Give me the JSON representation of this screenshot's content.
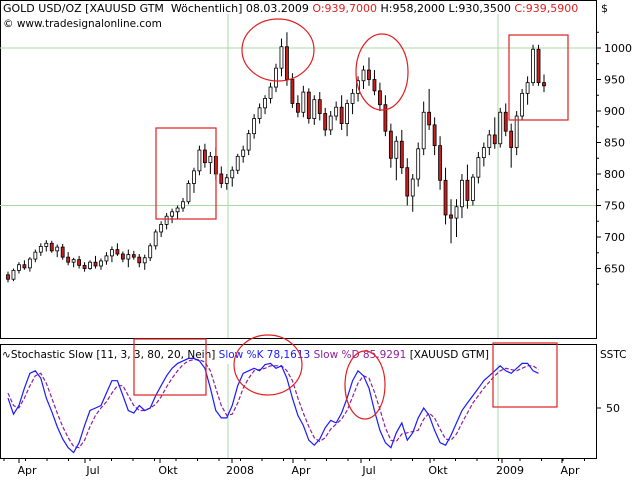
{
  "header": {
    "symbol": "GOLD USD/OZ [XAUUSD GTM  Wöchentlich]",
    "date": "08.03.2009",
    "open": "O:939,7000",
    "high": "H:958,2000",
    "low": "L:930,3500",
    "close": "C:939,5900",
    "site": "www.tradesignalonline.com",
    "currency": "$"
  },
  "oscillator": {
    "name": "Stochastic Slow [11, 3, 3, 80, 20, Nein]",
    "k_label": "Slow %K 78,1613",
    "d_label": "Slow %D 85,9291",
    "symbol": "[XAUUSD GTM]",
    "axis_name": "SSTC",
    "tick": "50"
  },
  "colors": {
    "up_candle": "#ffffff",
    "down_candle": "#cc1e1e",
    "k_line": "#1a1aff",
    "d_line": "#8f1f9f",
    "annotation": "#e02020",
    "gridline": "#a8d8a8",
    "background": "#ffffff",
    "axis": "#000000"
  },
  "chart_data": [
    {
      "type": "candlestick",
      "title": "GOLD USD/OZ [XAUUSD GTM  Wöchentlich]",
      "y_ticks": [
        650,
        700,
        750,
        800,
        850,
        900,
        950,
        1000
      ],
      "x_tick_labels": [
        "Apr",
        "Jul",
        "Okt",
        "2008",
        "Apr",
        "Jul",
        "Okt",
        "2009",
        "Apr"
      ],
      "ylim": [
        600,
        1035
      ],
      "grid": true,
      "candles_weekly_ohlc": [
        [
          640,
          645,
          628,
          633
        ],
        [
          633,
          650,
          630,
          647
        ],
        [
          647,
          660,
          642,
          656
        ],
        [
          656,
          663,
          648,
          651
        ],
        [
          651,
          668,
          645,
          665
        ],
        [
          665,
          680,
          660,
          676
        ],
        [
          676,
          690,
          670,
          685
        ],
        [
          685,
          695,
          677,
          690
        ],
        [
          690,
          694,
          675,
          678
        ],
        [
          678,
          688,
          668,
          684
        ],
        [
          684,
          689,
          664,
          668
        ],
        [
          668,
          676,
          655,
          660
        ],
        [
          660,
          667,
          652,
          664
        ],
        [
          664,
          670,
          650,
          655
        ],
        [
          655,
          660,
          645,
          650
        ],
        [
          650,
          663,
          648,
          660
        ],
        [
          660,
          670,
          650,
          654
        ],
        [
          654,
          666,
          648,
          662
        ],
        [
          662,
          676,
          656,
          670
        ],
        [
          670,
          685,
          660,
          680
        ],
        [
          680,
          690,
          670,
          673
        ],
        [
          673,
          677,
          660,
          665
        ],
        [
          665,
          680,
          652,
          672
        ],
        [
          672,
          678,
          664,
          668
        ],
        [
          668,
          673,
          652,
          659
        ],
        [
          659,
          672,
          648,
          667
        ],
        [
          667,
          690,
          662,
          686
        ],
        [
          686,
          712,
          680,
          708
        ],
        [
          708,
          725,
          700,
          720
        ],
        [
          720,
          738,
          712,
          733
        ],
        [
          733,
          745,
          722,
          740
        ],
        [
          740,
          750,
          728,
          746
        ],
        [
          746,
          762,
          740,
          756
        ],
        [
          756,
          790,
          752,
          785
        ],
        [
          785,
          810,
          770,
          805
        ],
        [
          805,
          845,
          798,
          838
        ],
        [
          838,
          848,
          810,
          818
        ],
        [
          818,
          835,
          800,
          828
        ],
        [
          828,
          842,
          790,
          800
        ],
        [
          800,
          812,
          778,
          785
        ],
        [
          785,
          800,
          775,
          794
        ],
        [
          794,
          812,
          780,
          806
        ],
        [
          806,
          832,
          800,
          828
        ],
        [
          828,
          845,
          818,
          838
        ],
        [
          838,
          870,
          830,
          864
        ],
        [
          864,
          895,
          856,
          888
        ],
        [
          888,
          912,
          880,
          905
        ],
        [
          905,
          925,
          895,
          920
        ],
        [
          920,
          945,
          912,
          938
        ],
        [
          938,
          975,
          930,
          968
        ],
        [
          968,
          1015,
          955,
          1002
        ],
        [
          1002,
          1025,
          940,
          950
        ],
        [
          950,
          960,
          905,
          912
        ],
        [
          912,
          925,
          890,
          898
        ],
        [
          898,
          940,
          890,
          930
        ],
        [
          930,
          936,
          880,
          888
        ],
        [
          888,
          925,
          878,
          918
        ],
        [
          918,
          930,
          885,
          896
        ],
        [
          896,
          905,
          860,
          870
        ],
        [
          870,
          900,
          862,
          892
        ],
        [
          892,
          915,
          885,
          906
        ],
        [
          906,
          925,
          870,
          880
        ],
        [
          880,
          918,
          860,
          912
        ],
        [
          912,
          935,
          895,
          928
        ],
        [
          928,
          955,
          915,
          948
        ],
        [
          948,
          972,
          935,
          965
        ],
        [
          965,
          985,
          940,
          950
        ],
        [
          950,
          965,
          925,
          932
        ],
        [
          932,
          945,
          900,
          910
        ],
        [
          910,
          925,
          860,
          868
        ],
        [
          868,
          880,
          810,
          825
        ],
        [
          825,
          860,
          790,
          852
        ],
        [
          852,
          870,
          800,
          810
        ],
        [
          810,
          825,
          750,
          765
        ],
        [
          765,
          800,
          740,
          792
        ],
        [
          792,
          850,
          780,
          840
        ],
        [
          840,
          915,
          830,
          898
        ],
        [
          898,
          935,
          870,
          878
        ],
        [
          878,
          890,
          830,
          845
        ],
        [
          845,
          860,
          775,
          790
        ],
        [
          790,
          810,
          720,
          735
        ],
        [
          735,
          760,
          690,
          730
        ],
        [
          730,
          760,
          700,
          748
        ],
        [
          748,
          800,
          730,
          790
        ],
        [
          790,
          815,
          745,
          758
        ],
        [
          758,
          800,
          750,
          795
        ],
        [
          795,
          835,
          785,
          826
        ],
        [
          826,
          850,
          812,
          842
        ],
        [
          842,
          870,
          830,
          862
        ],
        [
          862,
          890,
          840,
          848
        ],
        [
          848,
          905,
          842,
          898
        ],
        [
          898,
          912,
          860,
          868
        ],
        [
          868,
          880,
          810,
          842
        ],
        [
          842,
          900,
          830,
          892
        ],
        [
          892,
          935,
          885,
          928
        ],
        [
          928,
          955,
          910,
          945
        ],
        [
          945,
          1005,
          940,
          998
        ],
        [
          998,
          1005,
          940,
          945
        ],
        [
          945,
          958,
          930,
          940
        ]
      ],
      "annotation_boxes": 3,
      "annotation_circles": 2
    },
    {
      "type": "line",
      "title": "Stochastic Slow [11, 3, 3, 80, 20, Nein]",
      "y_ticks": [
        50
      ],
      "ylim": [
        0,
        100
      ],
      "series": [
        {
          "name": "Slow %K 78,1613",
          "values": [
            58,
            45,
            52,
            66,
            78,
            80,
            74,
            58,
            47,
            35,
            25,
            18,
            14,
            22,
            36,
            48,
            50,
            52,
            62,
            72,
            72,
            60,
            48,
            46,
            52,
            48,
            50,
            60,
            68,
            76,
            82,
            86,
            88,
            90,
            90,
            88,
            82,
            66,
            48,
            42,
            42,
            52,
            68,
            78,
            80,
            82,
            80,
            85,
            86,
            82,
            84,
            74,
            58,
            44,
            36,
            24,
            20,
            25,
            34,
            40,
            38,
            46,
            58,
            72,
            80,
            76,
            66,
            48,
            32,
            22,
            18,
            30,
            38,
            24,
            30,
            42,
            50,
            44,
            32,
            22,
            20,
            28,
            38,
            48,
            54,
            60,
            66,
            72,
            76,
            80,
            84,
            80,
            78,
            82,
            86,
            86,
            80,
            78
          ]
        },
        {
          "name": "Slow %D 85,9291",
          "values": [
            62,
            52,
            50,
            58,
            68,
            76,
            78,
            70,
            58,
            46,
            35,
            26,
            19,
            18,
            24,
            35,
            44,
            50,
            55,
            62,
            68,
            68,
            60,
            52,
            48,
            48,
            50,
            53,
            59,
            67,
            74,
            80,
            85,
            88,
            89,
            89,
            87,
            80,
            66,
            52,
            44,
            45,
            54,
            66,
            74,
            80,
            81,
            82,
            84,
            84,
            84,
            80,
            72,
            58,
            46,
            35,
            26,
            23,
            26,
            33,
            37,
            41,
            48,
            59,
            70,
            76,
            74,
            63,
            49,
            34,
            24,
            23,
            29,
            30,
            31,
            32,
            41,
            46,
            42,
            33,
            25,
            24,
            29,
            38,
            46,
            54,
            60,
            66,
            71,
            76,
            80,
            82,
            81,
            80,
            82,
            84,
            84,
            81
          ]
        }
      ]
    }
  ]
}
